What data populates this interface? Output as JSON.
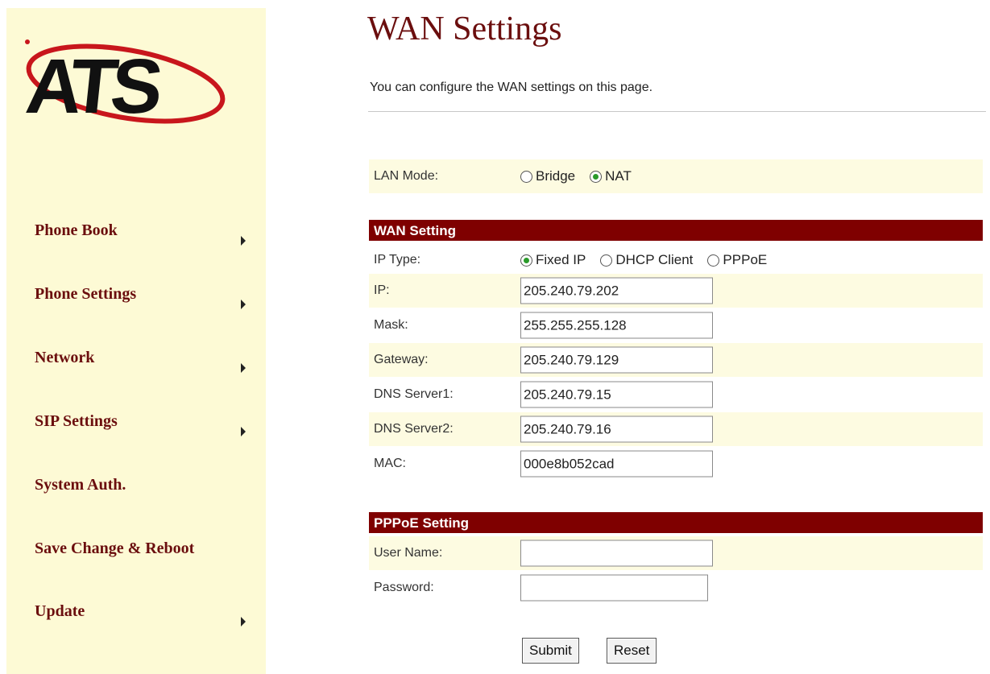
{
  "sidebar": {
    "logo_text": "ATS",
    "items": [
      {
        "label": "Phone Book",
        "has_arrow": true
      },
      {
        "label": "Phone Settings",
        "has_arrow": true
      },
      {
        "label": "Network",
        "has_arrow": true
      },
      {
        "label": "SIP Settings",
        "has_arrow": true
      },
      {
        "label": "System Auth.",
        "has_arrow": false
      },
      {
        "label": "Save Change & Reboot",
        "has_arrow": false
      },
      {
        "label": "Update",
        "has_arrow": true
      }
    ]
  },
  "page": {
    "title": "WAN Settings",
    "description": "You can configure the WAN settings on this page."
  },
  "lan_mode": {
    "label": "LAN Mode:",
    "options": [
      "Bridge",
      "NAT"
    ],
    "selected": "NAT"
  },
  "wan": {
    "header": "WAN Setting",
    "ip_type": {
      "label": "IP Type:",
      "options": [
        "Fixed IP",
        "DHCP Client",
        "PPPoE"
      ],
      "selected": "Fixed IP"
    },
    "fields": [
      {
        "label": "IP:",
        "value": "205.240.79.202"
      },
      {
        "label": "Mask:",
        "value": "255.255.255.128"
      },
      {
        "label": "Gateway:",
        "value": "205.240.79.129"
      },
      {
        "label": "DNS Server1:",
        "value": "205.240.79.15"
      },
      {
        "label": "DNS Server2:",
        "value": "205.240.79.16"
      },
      {
        "label": "MAC:",
        "value": "000e8b052cad"
      }
    ]
  },
  "pppoe": {
    "header": "PPPoE Setting",
    "fields": [
      {
        "label": "User Name:",
        "value": ""
      },
      {
        "label": "Password:",
        "value": ""
      }
    ]
  },
  "buttons": {
    "submit": "Submit",
    "reset": "Reset"
  },
  "colors": {
    "brand": "#6b0e0e",
    "section_header": "#7f0000",
    "sidebar_bg": "#fdfad5",
    "radio_selected": "#2a9a2a"
  }
}
